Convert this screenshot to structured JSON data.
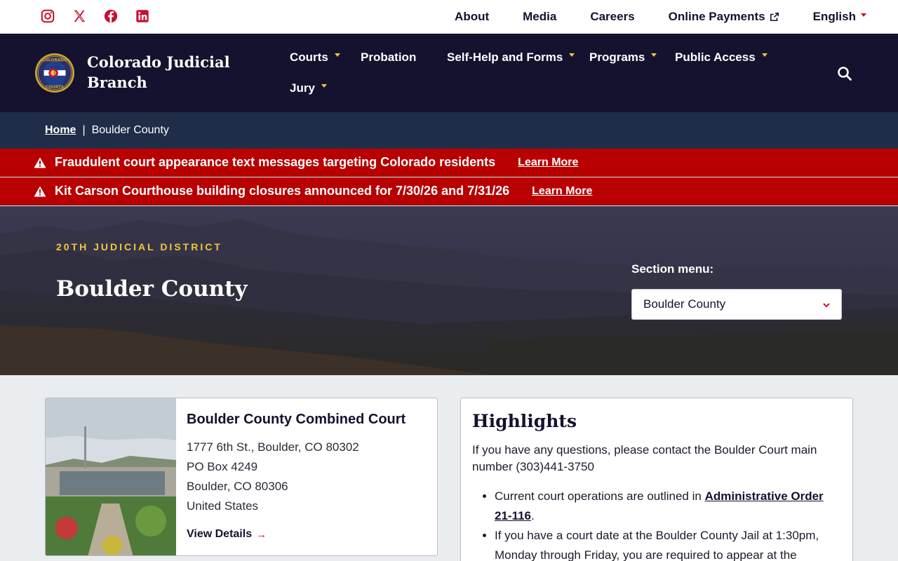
{
  "utility": {
    "social": [
      {
        "name": "instagram-icon"
      },
      {
        "name": "x-twitter-icon"
      },
      {
        "name": "facebook-icon"
      },
      {
        "name": "linkedin-icon"
      }
    ],
    "links": [
      "About",
      "Media",
      "Careers",
      "Online Payments"
    ],
    "language": "English"
  },
  "header": {
    "brand": "Colorado Judicial Branch",
    "nav": [
      "Courts",
      "Probation",
      "Self-Help and Forms",
      "Programs",
      "Public Access",
      "Jury"
    ]
  },
  "breadcrumb": {
    "home": "Home",
    "separator": "|",
    "current": "Boulder County"
  },
  "alerts": [
    {
      "text": "Fraudulent court appearance text messages targeting Colorado residents",
      "link": "Learn More"
    },
    {
      "text": "Kit Carson Courthouse building closures announced for 7/30/26 and 7/31/26",
      "link": "Learn More"
    }
  ],
  "hero": {
    "eyebrow": "20TH JUDICIAL DISTRICT",
    "title": "Boulder County",
    "section_label": "Section menu:",
    "section_value": "Boulder County"
  },
  "court_card": {
    "title": "Boulder County Combined Court",
    "address": [
      "1777 6th St., Boulder, CO 80302",
      "PO Box 4249",
      "Boulder, CO 80306",
      "United States"
    ],
    "link": "View Details"
  },
  "highlights": {
    "title": "Highlights",
    "intro": "If you have any questions, please contact the Boulder Court main number (303)441-3750",
    "item1_pre": "Current court operations are outlined in ",
    "item1_link": "Administrative Order 21-116",
    "item1_post": ".",
    "item2": "If you have a court date at the Boulder County Jail at 1:30pm, Monday through Friday, you are required to appear at the"
  },
  "colors": {
    "navy": "#14122e",
    "crumb_bg": "#1f2d49",
    "alert_red": "#b80000",
    "gold": "#f4c542",
    "accent_red": "#c8102e"
  }
}
